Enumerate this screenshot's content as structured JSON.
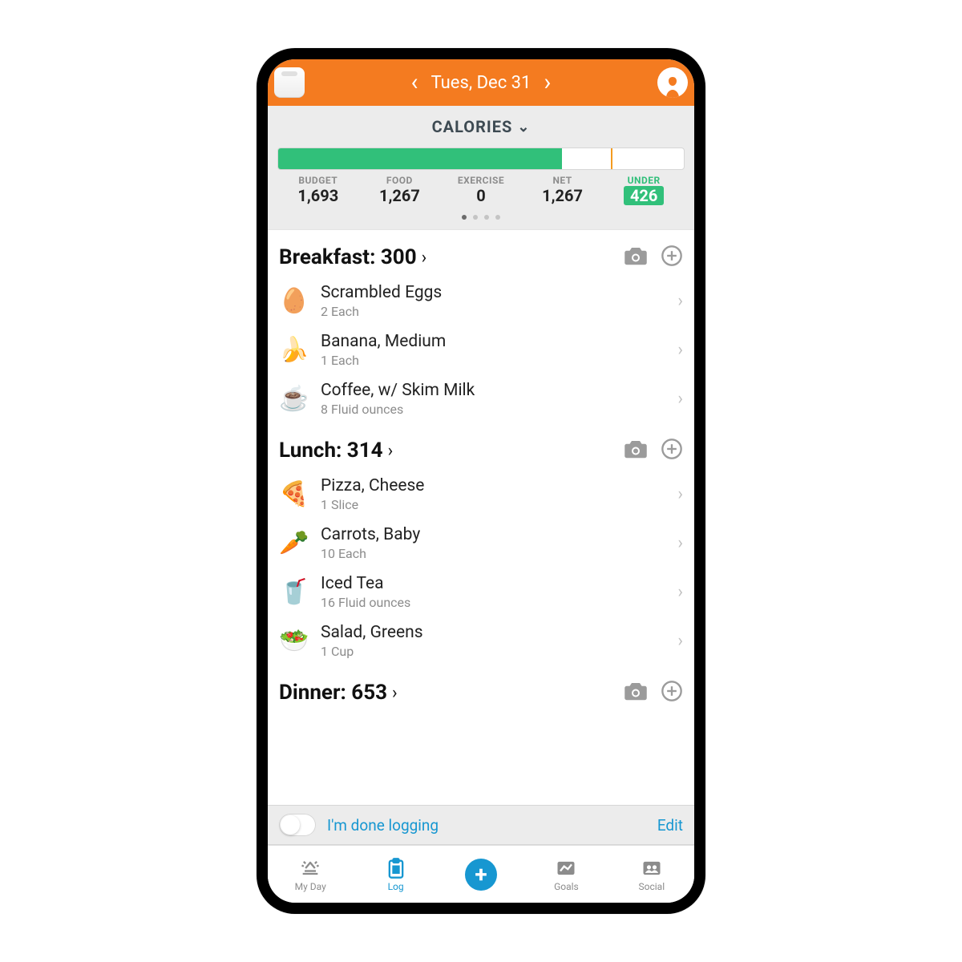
{
  "header": {
    "date": "Tues, Dec 31"
  },
  "summary": {
    "title": "CALORIES",
    "progress_pct": 70,
    "marker_pct": 82,
    "stats": [
      {
        "label": "BUDGET",
        "value": "1,693"
      },
      {
        "label": "FOOD",
        "value": "1,267"
      },
      {
        "label": "EXERCISE",
        "value": "0"
      },
      {
        "label": "NET",
        "value": "1,267"
      }
    ],
    "under_label": "UNDER",
    "under_value": "426"
  },
  "meals": [
    {
      "title": "Breakfast: 300",
      "items": [
        {
          "emoji": "🥚",
          "name": "Scrambled Eggs",
          "qty": "2 Each"
        },
        {
          "emoji": "🍌",
          "name": "Banana, Medium",
          "qty": "1 Each"
        },
        {
          "emoji": "☕",
          "name": "Coffee, w/ Skim Milk",
          "qty": "8 Fluid ounces"
        }
      ]
    },
    {
      "title": "Lunch: 314",
      "items": [
        {
          "emoji": "🍕",
          "name": "Pizza, Cheese",
          "qty": "1 Slice"
        },
        {
          "emoji": "🥕",
          "name": "Carrots, Baby",
          "qty": "10 Each"
        },
        {
          "emoji": "🥤",
          "name": "Iced Tea",
          "qty": "16 Fluid ounces"
        },
        {
          "emoji": "🥗",
          "name": "Salad, Greens",
          "qty": "1 Cup"
        }
      ]
    },
    {
      "title": "Dinner: 653",
      "items": []
    }
  ],
  "footer": {
    "done_text": "I'm done logging",
    "edit_text": "Edit"
  },
  "tabs": [
    {
      "label": "My Day"
    },
    {
      "label": "Log"
    },
    {
      "label": ""
    },
    {
      "label": "Goals"
    },
    {
      "label": "Social"
    }
  ]
}
